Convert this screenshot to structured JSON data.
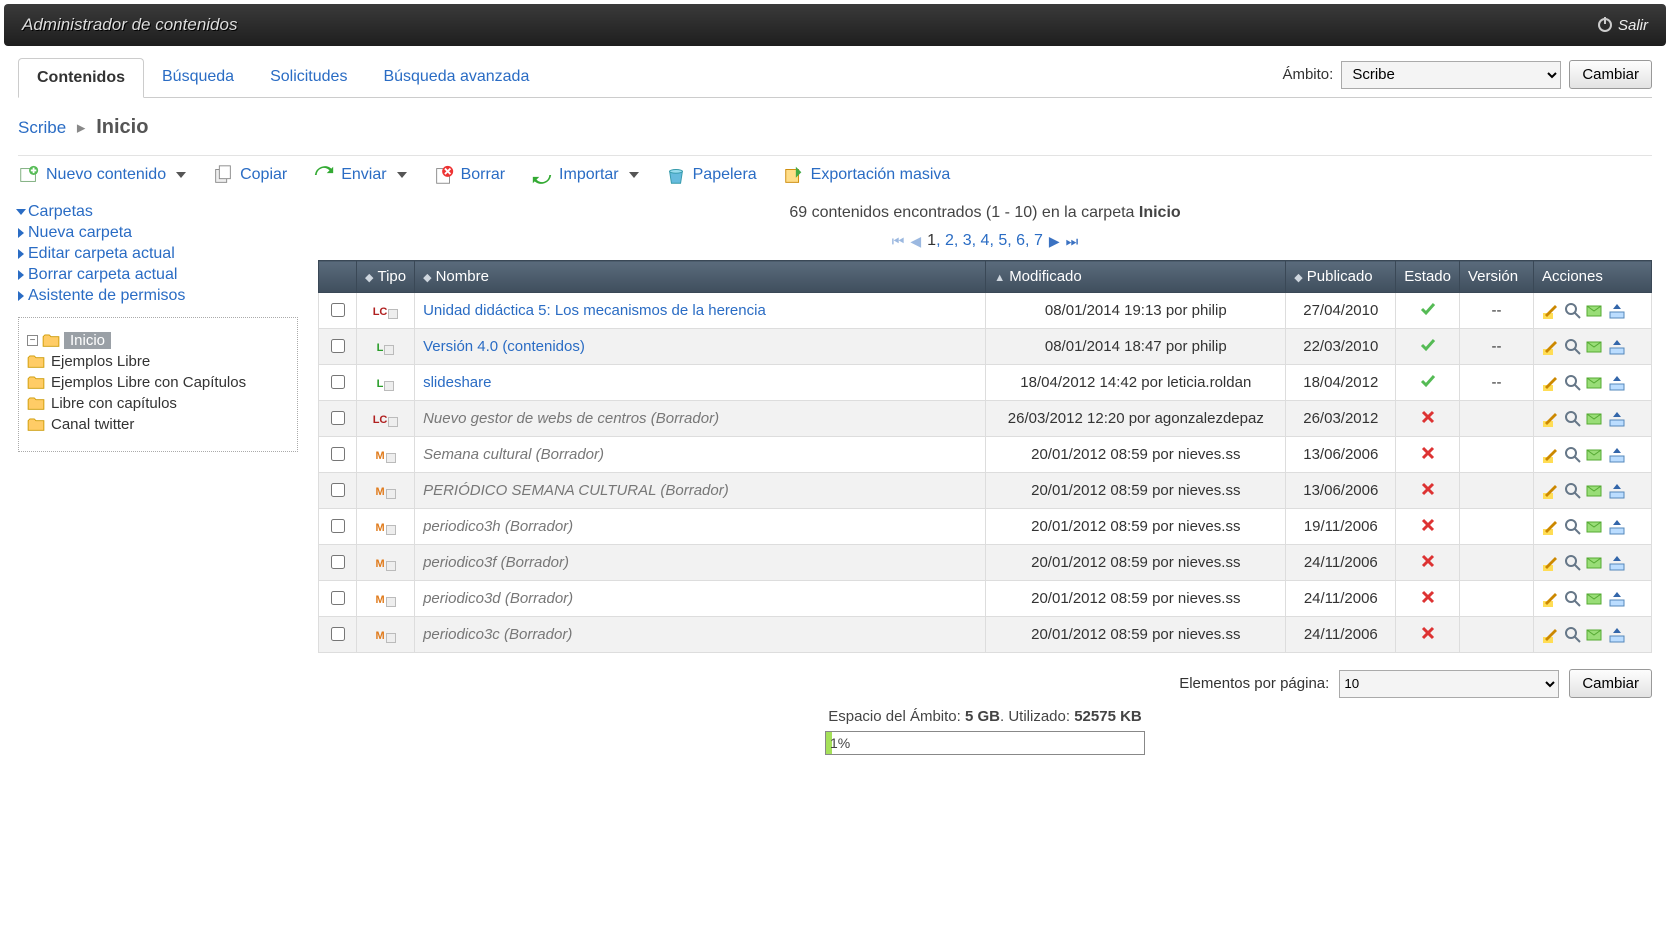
{
  "topbar": {
    "title": "Administrador de contenidos",
    "logout": "Salir"
  },
  "tabs": [
    "Contenidos",
    "Búsqueda",
    "Solicitudes",
    "Búsqueda avanzada"
  ],
  "scope": {
    "label": "Ámbito:",
    "value": "Scribe",
    "change": "Cambiar"
  },
  "breadcrumb": {
    "root": "Scribe",
    "current": "Inicio"
  },
  "toolbar": {
    "new": "Nuevo contenido",
    "copy": "Copiar",
    "send": "Enviar",
    "delete": "Borrar",
    "import": "Importar",
    "trash": "Papelera",
    "export": "Exportación masiva"
  },
  "sideActions": {
    "folders": "Carpetas",
    "newFolder": "Nueva carpeta",
    "editFolder": "Editar carpeta actual",
    "deleteFolder": "Borrar carpeta actual",
    "perms": "Asistente de permisos"
  },
  "tree": {
    "root": "Inicio",
    "children": [
      "Ejemplos Libre",
      "Ejemplos Libre con Capítulos",
      "Libre con capítulos",
      "Canal twitter"
    ]
  },
  "summary": {
    "pre": "69 contenidos encontrados (1 - 10) en la carpeta ",
    "folder": "Inicio"
  },
  "pager": {
    "pages": [
      "1",
      "2",
      "3",
      "4",
      "5",
      "6",
      "7"
    ],
    "current": 1
  },
  "cols": {
    "tipo": "Tipo",
    "nombre": "Nombre",
    "mod": "Modificado",
    "pub": "Publicado",
    "est": "Estado",
    "ver": "Versión",
    "acc": "Acciones"
  },
  "rows": [
    {
      "type": "LC",
      "name": "Unidad didáctica 5: Los mecanismos de la herencia",
      "draft": false,
      "link": true,
      "mod": "08/01/2014 19:13 por philip",
      "pub": "27/04/2010",
      "ok": true,
      "ver": "--"
    },
    {
      "type": "L",
      "name": "Versión 4.0 (contenidos)",
      "draft": false,
      "link": true,
      "mod": "08/01/2014 18:47 por philip",
      "pub": "22/03/2010",
      "ok": true,
      "ver": "--"
    },
    {
      "type": "L",
      "name": "slideshare",
      "draft": false,
      "link": true,
      "mod": "18/04/2012 14:42 por leticia.roldan",
      "pub": "18/04/2012",
      "ok": true,
      "ver": "--"
    },
    {
      "type": "LC",
      "name": "Nuevo gestor de webs de centros (Borrador)",
      "draft": true,
      "link": false,
      "mod": "26/03/2012 12:20 por agonzalezdepaz",
      "pub": "26/03/2012",
      "ok": false,
      "ver": ""
    },
    {
      "type": "M",
      "name": "Semana cultural (Borrador)",
      "draft": true,
      "link": false,
      "mod": "20/01/2012 08:59 por nieves.ss",
      "pub": "13/06/2006",
      "ok": false,
      "ver": ""
    },
    {
      "type": "M",
      "name": "PERIÓDICO SEMANA CULTURAL (Borrador)",
      "draft": true,
      "link": false,
      "mod": "20/01/2012 08:59 por nieves.ss",
      "pub": "13/06/2006",
      "ok": false,
      "ver": ""
    },
    {
      "type": "M",
      "name": "periodico3h (Borrador)",
      "draft": true,
      "link": false,
      "mod": "20/01/2012 08:59 por nieves.ss",
      "pub": "19/11/2006",
      "ok": false,
      "ver": ""
    },
    {
      "type": "M",
      "name": "periodico3f (Borrador)",
      "draft": true,
      "link": false,
      "mod": "20/01/2012 08:59 por nieves.ss",
      "pub": "24/11/2006",
      "ok": false,
      "ver": ""
    },
    {
      "type": "M",
      "name": "periodico3d (Borrador)",
      "draft": true,
      "link": false,
      "mod": "20/01/2012 08:59 por nieves.ss",
      "pub": "24/11/2006",
      "ok": false,
      "ver": ""
    },
    {
      "type": "M",
      "name": "periodico3c (Borrador)",
      "draft": true,
      "link": false,
      "mod": "20/01/2012 08:59 por nieves.ss",
      "pub": "24/11/2006",
      "ok": false,
      "ver": ""
    }
  ],
  "perpage": {
    "label": "Elementos por página:",
    "value": "10",
    "change": "Cambiar"
  },
  "disk": {
    "pre": "Espacio del Ámbito: ",
    "total": "5 GB",
    "mid": ". Utilizado: ",
    "used": "52575 KB",
    "pct": "1%"
  }
}
